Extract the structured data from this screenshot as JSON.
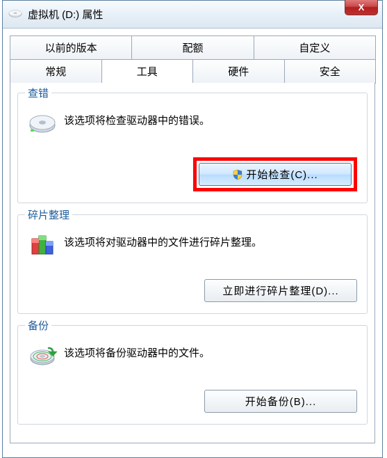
{
  "window": {
    "title": "虚拟机 (D:) 属性",
    "close_label": "X"
  },
  "tabs": {
    "row1": [
      {
        "label": "以前的版本"
      },
      {
        "label": "配额"
      },
      {
        "label": "自定义"
      }
    ],
    "row2": [
      {
        "label": "常规"
      },
      {
        "label": "工具"
      },
      {
        "label": "硬件"
      },
      {
        "label": "安全"
      }
    ]
  },
  "groups": {
    "check": {
      "title": "查错",
      "text": "该选项将检查驱动器中的错误。",
      "button": "开始检查(C)..."
    },
    "defrag": {
      "title": "碎片整理",
      "text": "该选项将对驱动器中的文件进行碎片整理。",
      "button": "立即进行碎片整理(D)..."
    },
    "backup": {
      "title": "备份",
      "text": "该选项将备份驱动器中的文件。",
      "button": "开始备份(B)..."
    }
  }
}
